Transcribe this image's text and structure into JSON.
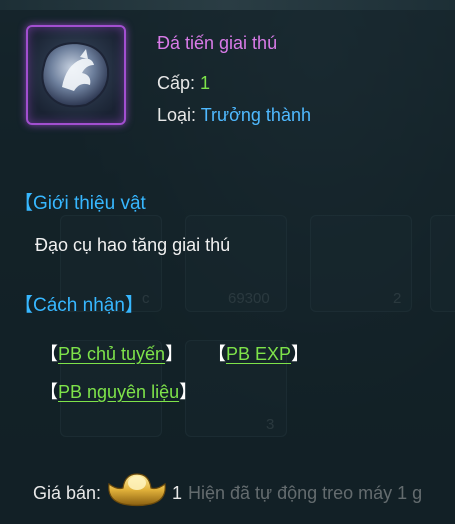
{
  "item": {
    "name": "Đá tiến giai thú",
    "level_label": "Cấp:",
    "level_value": "1",
    "type_label": "Loại:",
    "type_value": "Trưởng thành"
  },
  "sections": {
    "intro_title": "【Giới thiệu vật",
    "intro_text": "Đạo cụ hao tăng giai thú",
    "obtain_title": "【Cách nhận】"
  },
  "sources": [
    {
      "label": "PB chủ tuyến"
    },
    {
      "label": "PB EXP"
    },
    {
      "label": "PB nguyên liệu"
    }
  ],
  "price": {
    "label": "Giá bán:",
    "value": "1"
  },
  "background": {
    "slot_counts": [
      "c",
      "69300",
      "2",
      "3"
    ],
    "notice": "Hiện đã tự động treo máy 1 g"
  },
  "colors": {
    "name": "#d97be8",
    "green": "#7ee34a",
    "blue": "#4fb9ff",
    "section": "#37b7ff",
    "frame": "#a24fd0"
  },
  "icons": {
    "item": "beast-stone-icon",
    "currency": "gold-ingot-icon"
  }
}
